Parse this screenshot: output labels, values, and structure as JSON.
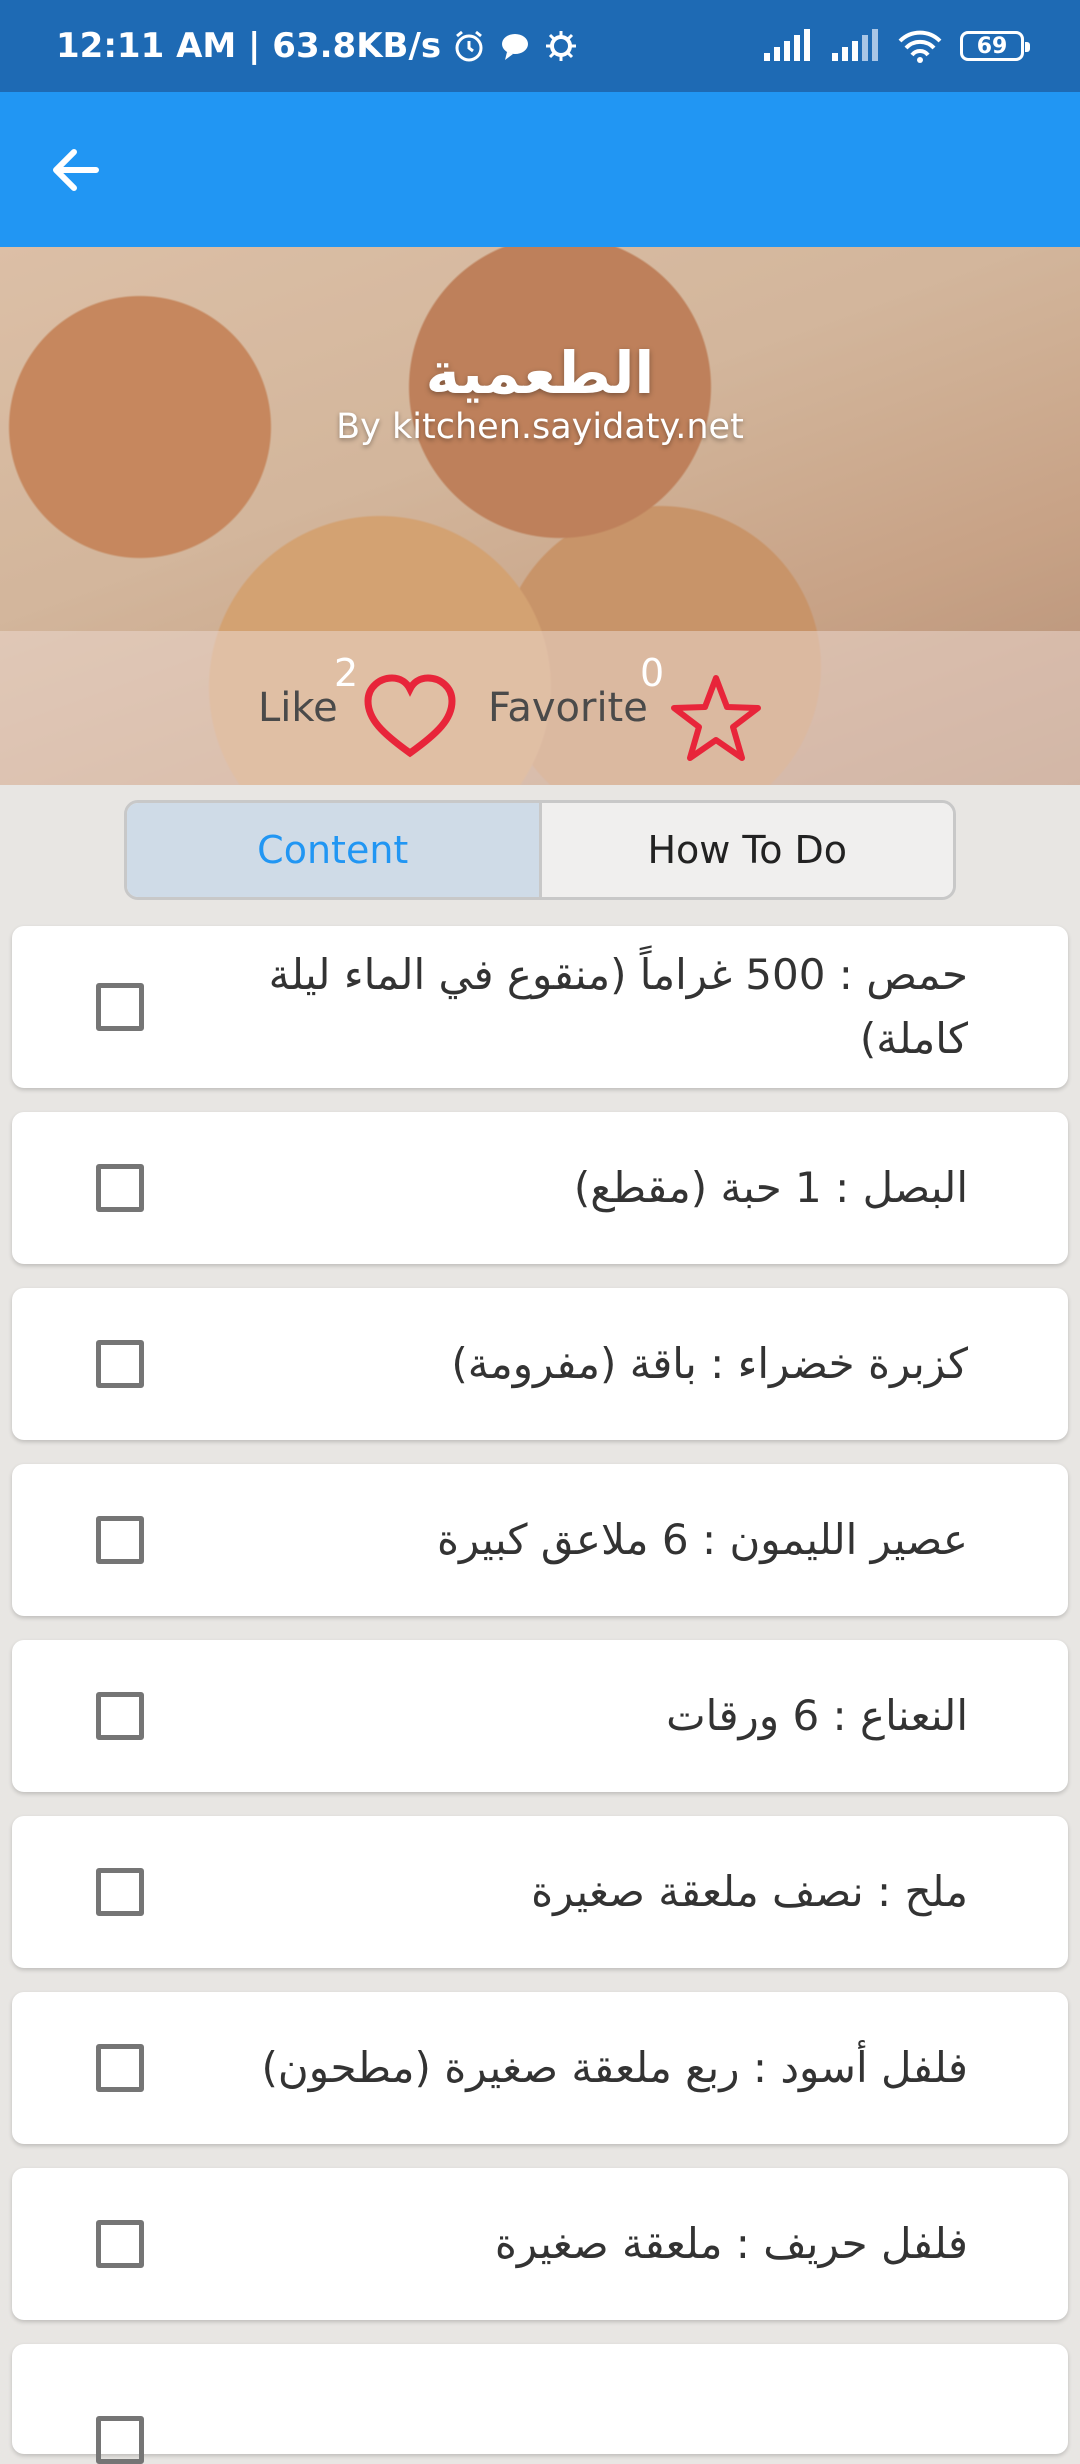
{
  "status_bar": {
    "time": "12:11 AM | 63.8KB/s",
    "battery": "69"
  },
  "recipe": {
    "title": "الطعمية",
    "source": "By kitchen.sayidaty.net",
    "like_label": "Like",
    "like_count": "2",
    "favorite_label": "Favorite",
    "favorite_count": "0"
  },
  "tabs": [
    {
      "label": "Content",
      "selected": true
    },
    {
      "label": "How To Do",
      "selected": false
    }
  ],
  "ingredients": [
    "حمص : 500 غراماً (منقوع في الماء ليلة كاملة)",
    "البصل : 1 حبة (مقطع)",
    "كزبرة خضراء : باقة (مفرومة)",
    "عصير الليمون : 6 ملاعق كبيرة",
    "النعناع : 6 ورقات",
    "ملح : نصف ملعقة صغيرة",
    "فلفل أسود : ربع ملعقة صغيرة (مطحون)",
    "فلفل حريف : ملعقة صغيرة"
  ],
  "colors": {
    "status_bar": "#1e6ab4",
    "app_bar": "#2196f3",
    "heart": "#e8253a",
    "star": "#e8253a"
  }
}
